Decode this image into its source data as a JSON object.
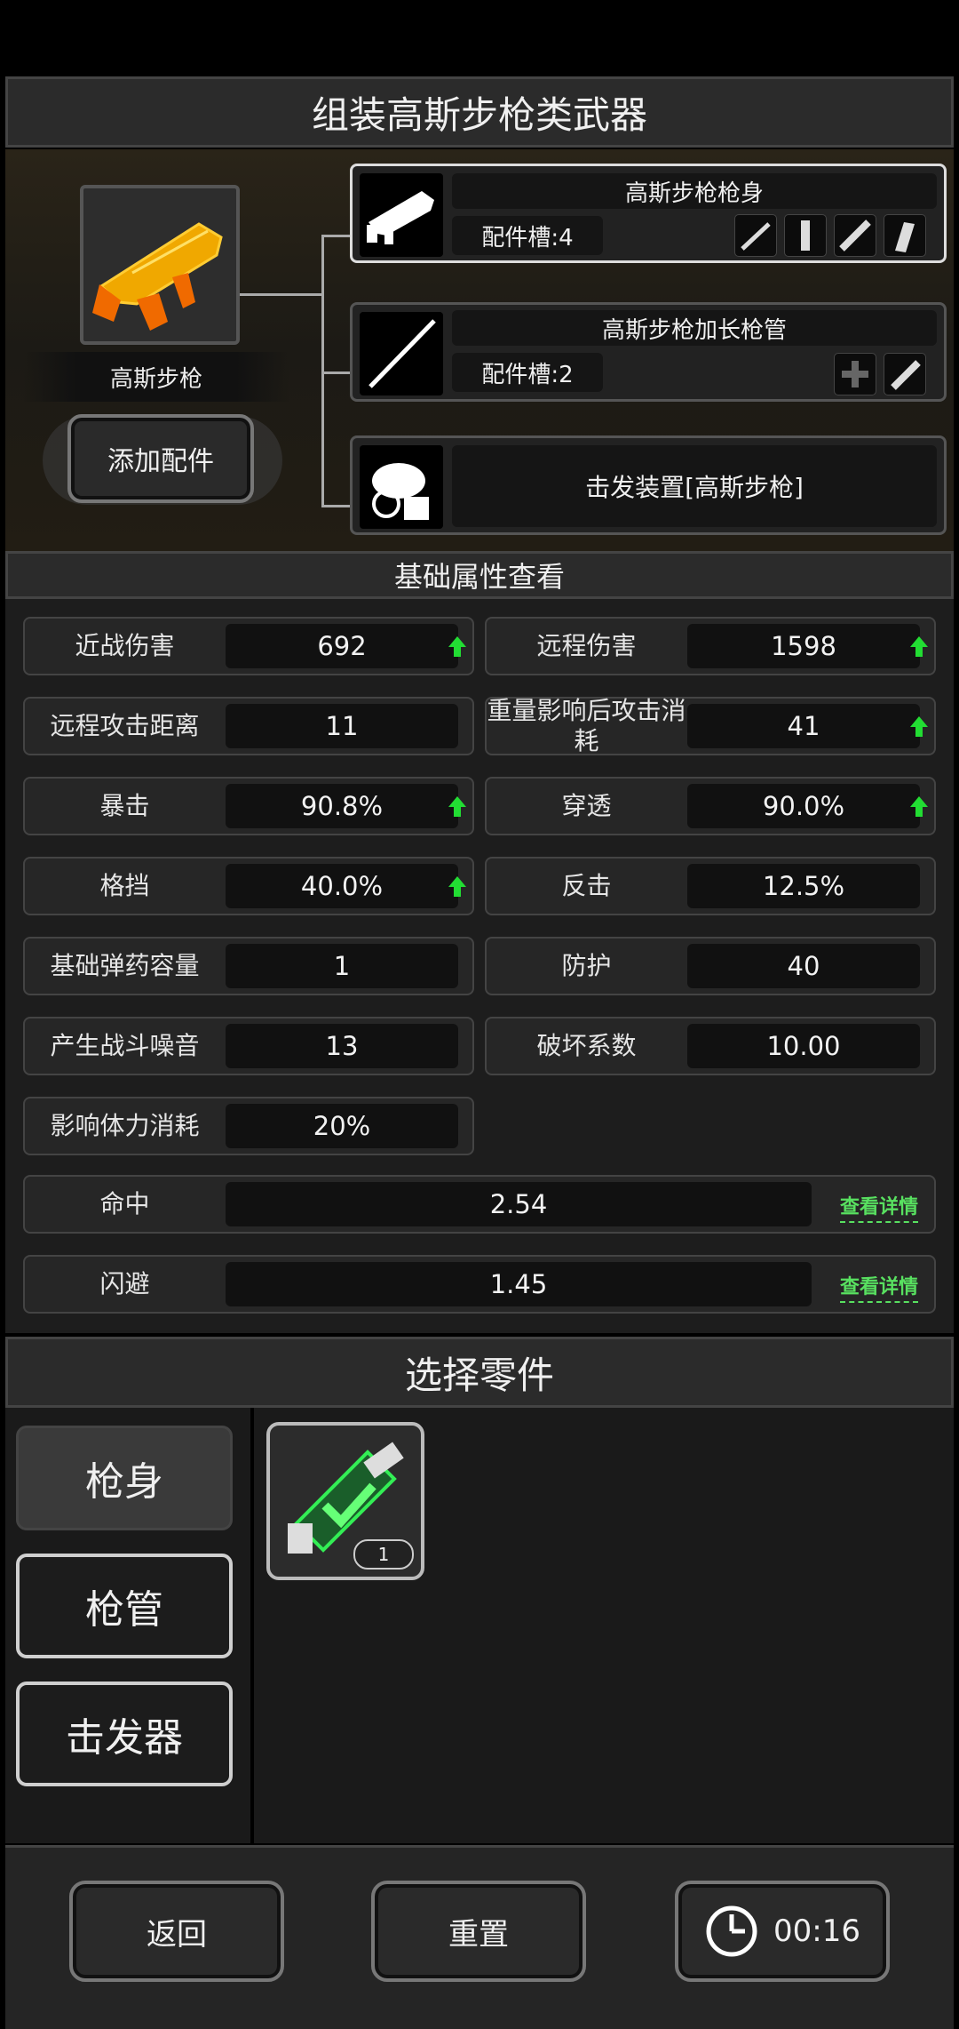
{
  "header": {
    "title": "组装高斯步枪类武器"
  },
  "weapon": {
    "name": "高斯步枪",
    "add_accessory_label": "添加配件"
  },
  "parts": [
    {
      "name": "高斯步枪枪身",
      "slots_label": "配件槽:4"
    },
    {
      "name": "高斯步枪加长枪管",
      "slots_label": "配件槽:2"
    },
    {
      "name": "击发装置[高斯步枪]"
    }
  ],
  "stats_section": {
    "title": "基础属性查看",
    "detail_label": "查看详情"
  },
  "stats": [
    {
      "label": "近战伤害",
      "value": "692",
      "up": true
    },
    {
      "label": "远程伤害",
      "value": "1598",
      "up": true
    },
    {
      "label": "远程攻击距离",
      "value": "11",
      "up": false
    },
    {
      "label": "重量影响后攻击消耗",
      "value": "41",
      "up": true
    },
    {
      "label": "暴击",
      "value": "90.8%",
      "up": true
    },
    {
      "label": "穿透",
      "value": "90.0%",
      "up": true
    },
    {
      "label": "格挡",
      "value": "40.0%",
      "up": true
    },
    {
      "label": "反击",
      "value": "12.5%",
      "up": false
    },
    {
      "label": "基础弹药容量",
      "value": "1",
      "up": false
    },
    {
      "label": "防护",
      "value": "40",
      "up": false
    },
    {
      "label": "产生战斗噪音",
      "value": "13",
      "up": false
    },
    {
      "label": "破坏系数",
      "value": "10.00",
      "up": false
    },
    {
      "label": "影响体力消耗",
      "value": "20%",
      "up": false
    }
  ],
  "wide_stats": [
    {
      "label": "命中",
      "value": "2.54"
    },
    {
      "label": "闪避",
      "value": "1.45"
    }
  ],
  "select_section": {
    "title": "选择零件"
  },
  "tabs": [
    {
      "label": "枪身",
      "active": true
    },
    {
      "label": "枪管",
      "active": false
    },
    {
      "label": "击发器",
      "active": false
    }
  ],
  "inventory": [
    {
      "count": "1"
    }
  ],
  "bottom": {
    "back_label": "返回",
    "reset_label": "重置",
    "timer": "00:16"
  },
  "colors": {
    "accent_green": "#22dd33",
    "detail_green": "#58e060"
  }
}
